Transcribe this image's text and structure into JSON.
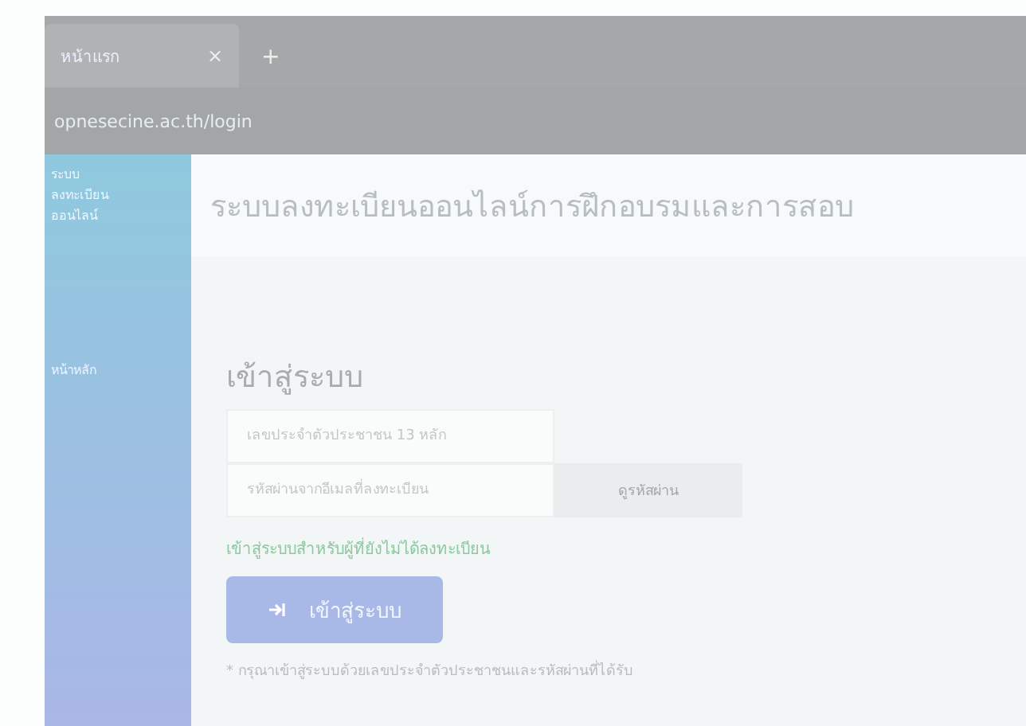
{
  "browser": {
    "tab_title": "หน้าแรก",
    "tab_close": "×",
    "new_tab": "+",
    "url": "opnesecine.ac.th/login"
  },
  "sidebar": {
    "brand": [
      "ระบบ",
      "ลงทะเบียน",
      "ออนไลน์"
    ],
    "items": [
      {
        "label": "หน้าหลัก",
        "selected": false
      }
    ]
  },
  "header": {
    "title": "ระบบลงทะเบียนออนไลน์การฝึกอบรมและการสอบ"
  },
  "login": {
    "heading": "เข้าสู่ระบบ",
    "fields": [
      {
        "placeholder": "เลขประจำตัวประชาชน 13 หลัก"
      },
      {
        "placeholder": "รหัสผ่านจากอีเมลที่ลงทะเบียน"
      }
    ],
    "show_password": "ดูรหัสผ่าน",
    "register_link": "เข้าสู่ระบบสำหรับผู้ที่ยังไม่ได้ลงทะเบียน",
    "submit": "เข้าสู่ระบบ",
    "note": "* กรุณาเข้าสู่ระบบด้วยเลขประจำตัวประชาชนและรหัสผ่านที่ได้รับ"
  }
}
